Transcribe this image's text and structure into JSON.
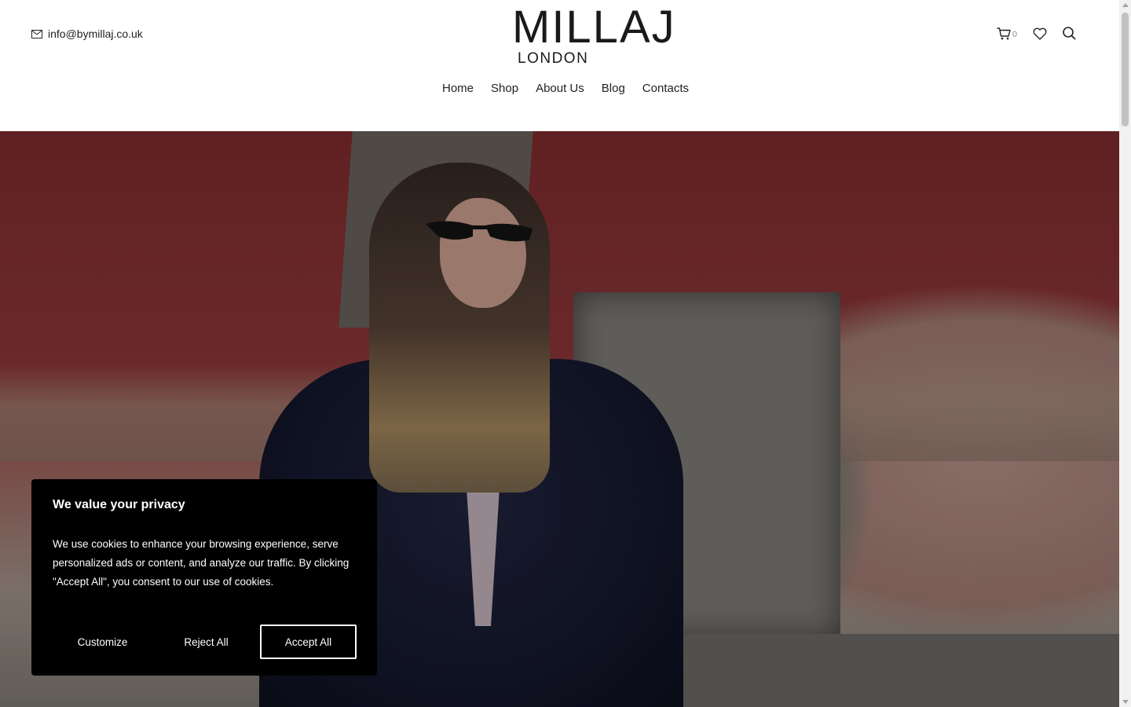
{
  "header": {
    "email": "info@bymillaj.co.uk",
    "logo_main": "MILLAJ",
    "logo_sub": "LONDON",
    "cart_count": "0"
  },
  "nav": {
    "items": [
      {
        "label": "Home"
      },
      {
        "label": "Shop"
      },
      {
        "label": "About Us"
      },
      {
        "label": "Blog"
      },
      {
        "label": "Contacts"
      }
    ]
  },
  "cookie_banner": {
    "title": "We value your privacy",
    "text": "We use cookies to enhance your browsing experience, serve personalized ads or content, and analyze our traffic. By clicking \"Accept All\", you consent to our use of cookies.",
    "customize_label": "Customize",
    "reject_label": "Reject All",
    "accept_label": "Accept All"
  },
  "icons": [
    "mail-icon",
    "cart-icon",
    "heart-icon",
    "search-icon"
  ],
  "colors": {
    "cookie_bg": "#000000",
    "text": "#222222"
  }
}
